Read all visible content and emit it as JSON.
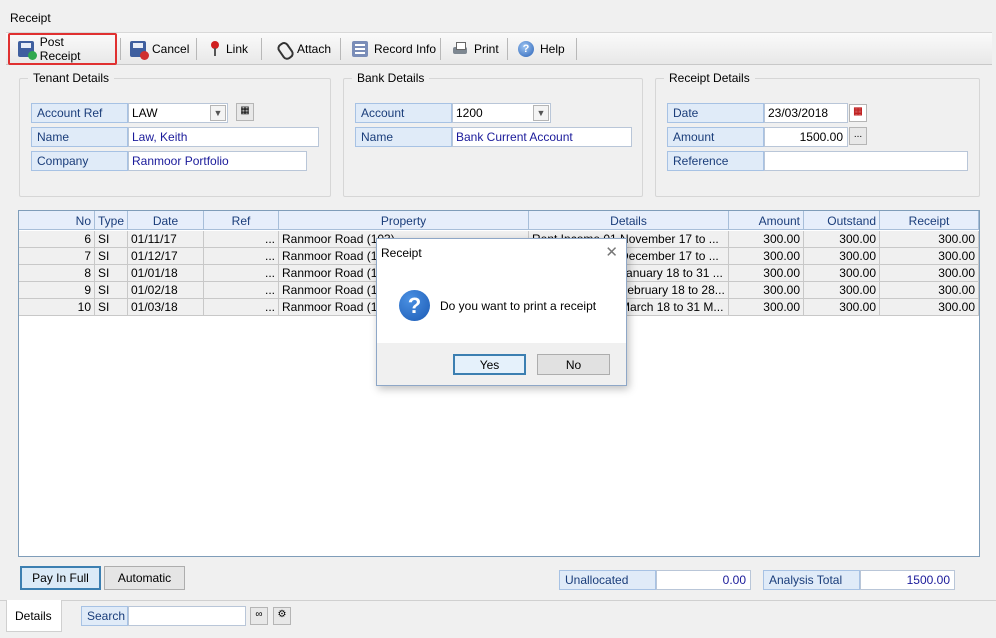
{
  "window": {
    "title": "Receipt"
  },
  "toolbar": {
    "post_receipt": "Post Receipt",
    "cancel": "Cancel",
    "link": "Link",
    "attach": "Attach",
    "record_info": "Record Info",
    "print": "Print",
    "help": "Help"
  },
  "tenant": {
    "title": "Tenant Details",
    "account_ref_label": "Account Ref",
    "account_ref_value": "LAW",
    "name_label": "Name",
    "name_value": "Law, Keith",
    "company_label": "Company",
    "company_value": "Ranmoor Portfolio"
  },
  "bank": {
    "title": "Bank Details",
    "account_label": "Account",
    "account_value": "1200",
    "name_label": "Name",
    "name_value": "Bank Current Account"
  },
  "receipt": {
    "title": "Receipt Details",
    "date_label": "Date",
    "date_value": "23/03/2018",
    "amount_label": "Amount",
    "amount_value": "1500.00",
    "reference_label": "Reference",
    "reference_value": "",
    "ellipsis": "..."
  },
  "grid": {
    "headers": [
      "No",
      "Type",
      "Date",
      "Ref",
      "Property",
      "Details",
      "Amount",
      "Outstand",
      "Receipt"
    ],
    "rows": [
      [
        "6",
        "SI",
        "01/11/17",
        "...",
        "Ranmoor Road (103)",
        "Rent Income 01 November 17 to ...",
        "300.00",
        "300.00",
        "300.00"
      ],
      [
        "7",
        "SI",
        "01/12/17",
        "...",
        "Ranmoor Road (103)",
        "Rent Income 01 December 17 to ...",
        "300.00",
        "300.00",
        "300.00"
      ],
      [
        "8",
        "SI",
        "01/01/18",
        "...",
        "Ranmoor Road (103)",
        "Rent Income 01 January 18 to 31 ...",
        "300.00",
        "300.00",
        "300.00"
      ],
      [
        "9",
        "SI",
        "01/02/18",
        "...",
        "Ranmoor Road (103)",
        "Rent Income 01 February 18 to 28...",
        "300.00",
        "300.00",
        "300.00"
      ],
      [
        "10",
        "SI",
        "01/03/18",
        "...",
        "Ranmoor Road (103)",
        "Rent Income 01 March 18 to 31 M...",
        "300.00",
        "300.00",
        "300.00"
      ]
    ]
  },
  "buttons": {
    "pay_in_full": "Pay In Full",
    "automatic": "Automatic"
  },
  "totals": {
    "unallocated_label": "Unallocated",
    "unallocated_value": "0.00",
    "analysis_total_label": "Analysis Total",
    "analysis_total_value": "1500.00"
  },
  "status": {
    "details_tab": "Details",
    "search_label": "Search",
    "search_value": ""
  },
  "dialog": {
    "title": "Receipt",
    "message": "Do you want to print a receipt",
    "yes": "Yes",
    "no": "No",
    "icon": "question-icon"
  }
}
